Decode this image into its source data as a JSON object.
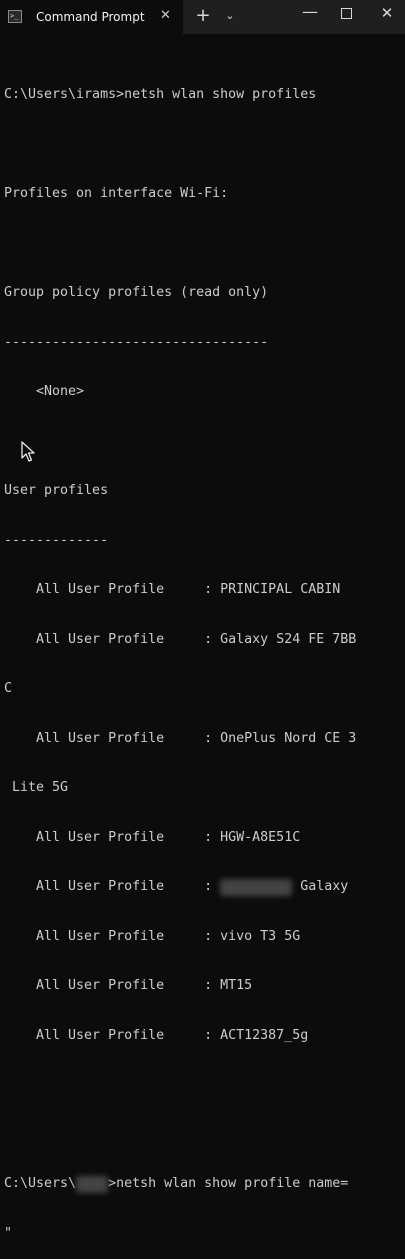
{
  "window": {
    "tab_title": "Command Prompt",
    "tab_icon_text": ">_",
    "close_tab": "✕",
    "new_tab": "+",
    "dropdown": "⌄",
    "minimize": "—",
    "close_window": "✕"
  },
  "terminal": {
    "lines": [
      "",
      "C:\\Users\\irams>netsh wlan show profiles",
      "",
      "Profiles on interface Wi-Fi:",
      "",
      "Group policy profiles (read only)",
      "---------------------------------",
      "    <None>",
      "",
      "User profiles",
      "-------------",
      "    All User Profile     : PRINCIPAL CABIN",
      "    All User Profile     : Galaxy S24 FE 7BB",
      "C",
      "    All User Profile     : OnePlus Nord CE 3",
      " Lite 5G",
      "    All User Profile     : HGW-A8E51C",
      "    All User Profile     : ",
      "    All User Profile     : vivo T3 5G",
      "    All User Profile     : MT15",
      "    All User Profile     : ACT12387_5g",
      "",
      "",
      "C:\\Users\\",
      "\""
    ],
    "blurred_profile_suffix": " Galaxy",
    "prompt2_suffix": ">netsh wlan show profile name="
  }
}
